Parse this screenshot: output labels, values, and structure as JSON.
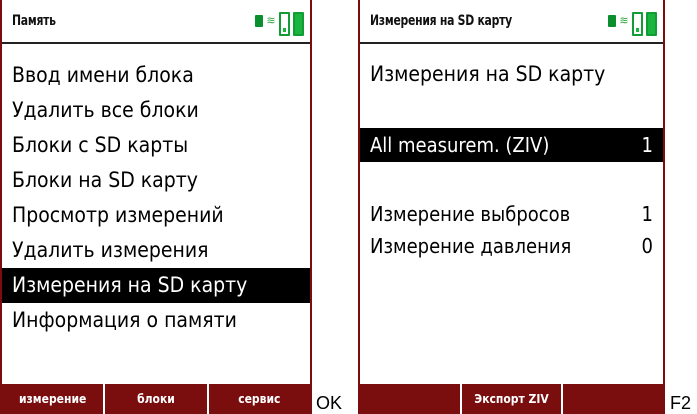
{
  "left_screen": {
    "title": "Память",
    "menu": [
      "Ввод имени блока",
      "Удалить все блоки",
      "Блоки  с SD карты",
      "Блоки  на SD карту",
      "Просмотр измерений",
      "Удалить измерения",
      "Измерения на SD карту",
      "Информация о памяти"
    ],
    "selected_index": 6,
    "softkeys": [
      "измерение",
      "блоки",
      "сервис"
    ],
    "key_label": "OK"
  },
  "right_screen": {
    "title": "Измерения на SD карту",
    "heading": "Измерения на SD карту",
    "rows": [
      {
        "label": "All measurem. (ZIV)",
        "count": "1"
      },
      {
        "label": "Измерение выбросов",
        "count": "1"
      },
      {
        "label": "Измерение давления",
        "count": "0"
      }
    ],
    "softkeys": [
      "",
      "Экспорт ZIV",
      ""
    ],
    "key_label": "F2"
  },
  "status_icons": [
    "sd-card-icon",
    "wifi-icon",
    "battery-low-icon",
    "battery-full-icon"
  ],
  "colors": {
    "softkey_bg": "#7a0d0d",
    "battery_green": "#19b53e",
    "selection_bg": "#000000"
  }
}
